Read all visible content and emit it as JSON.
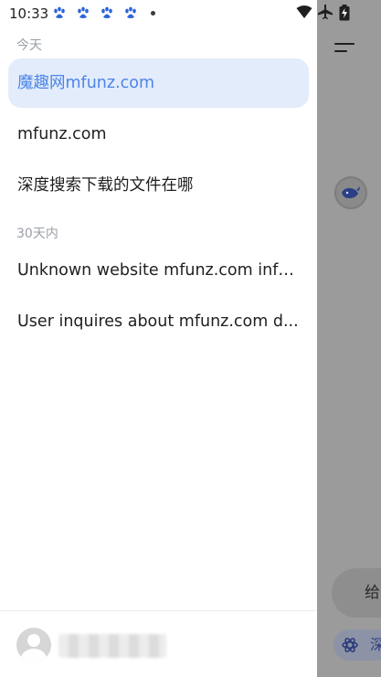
{
  "status_bar": {
    "time": "10:33",
    "notification_icons": [
      "paw-icon",
      "paw-icon",
      "paw-icon",
      "paw-icon"
    ]
  },
  "drawer": {
    "sections": [
      {
        "label": "今天",
        "items": [
          {
            "title": "魔趣网mfunz.com",
            "active": true
          },
          {
            "title": "mfunz.com",
            "active": false
          },
          {
            "title": "深度搜索下载的文件在哪",
            "active": false
          }
        ]
      },
      {
        "label": "30天内",
        "items": [
          {
            "title": "Unknown website mfunz.com info...",
            "active": false
          },
          {
            "title": "User inquires about mfunz.com d...",
            "active": false
          }
        ]
      }
    ],
    "user": {
      "name": "",
      "avatar": "default-avatar"
    }
  },
  "background": {
    "suggest_chip": "给 De",
    "deep_chip": "深"
  },
  "colors": {
    "accent": "#4c85e8",
    "active_bg": "#e3ecfb",
    "backdrop": "#9b9b9b"
  }
}
